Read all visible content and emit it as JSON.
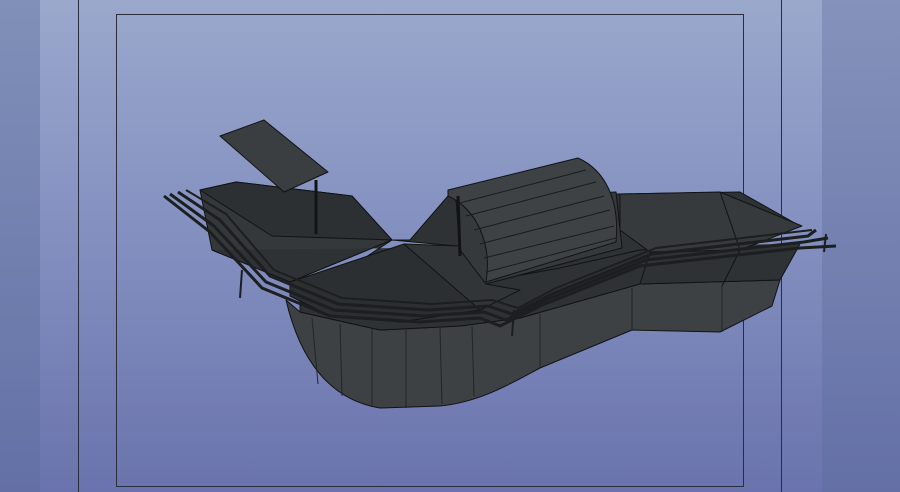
{
  "viewport": {
    "background_top": "#9aa8cc",
    "background_bottom": "#6a73ad",
    "frame_color": "#2a2e3c"
  },
  "model": {
    "object": "3d-ship-model",
    "render_style": "shaded-wireframe",
    "hull_color": "#3b3f42",
    "deck_color": "#2f3335",
    "edge_color": "#111314"
  }
}
